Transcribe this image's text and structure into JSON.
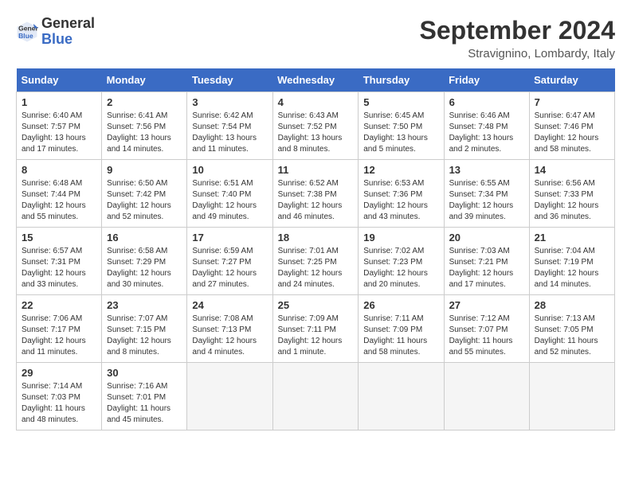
{
  "header": {
    "logo_line1": "General",
    "logo_line2": "Blue",
    "month": "September 2024",
    "location": "Stravignino, Lombardy, Italy"
  },
  "weekdays": [
    "Sunday",
    "Monday",
    "Tuesday",
    "Wednesday",
    "Thursday",
    "Friday",
    "Saturday"
  ],
  "weeks": [
    [
      {
        "day": "1",
        "sunrise": "6:40 AM",
        "sunset": "7:57 PM",
        "daylight": "13 hours and 17 minutes."
      },
      {
        "day": "2",
        "sunrise": "6:41 AM",
        "sunset": "7:56 PM",
        "daylight": "13 hours and 14 minutes."
      },
      {
        "day": "3",
        "sunrise": "6:42 AM",
        "sunset": "7:54 PM",
        "daylight": "13 hours and 11 minutes."
      },
      {
        "day": "4",
        "sunrise": "6:43 AM",
        "sunset": "7:52 PM",
        "daylight": "13 hours and 8 minutes."
      },
      {
        "day": "5",
        "sunrise": "6:45 AM",
        "sunset": "7:50 PM",
        "daylight": "13 hours and 5 minutes."
      },
      {
        "day": "6",
        "sunrise": "6:46 AM",
        "sunset": "7:48 PM",
        "daylight": "13 hours and 2 minutes."
      },
      {
        "day": "7",
        "sunrise": "6:47 AM",
        "sunset": "7:46 PM",
        "daylight": "12 hours and 58 minutes."
      }
    ],
    [
      {
        "day": "8",
        "sunrise": "6:48 AM",
        "sunset": "7:44 PM",
        "daylight": "12 hours and 55 minutes."
      },
      {
        "day": "9",
        "sunrise": "6:50 AM",
        "sunset": "7:42 PM",
        "daylight": "12 hours and 52 minutes."
      },
      {
        "day": "10",
        "sunrise": "6:51 AM",
        "sunset": "7:40 PM",
        "daylight": "12 hours and 49 minutes."
      },
      {
        "day": "11",
        "sunrise": "6:52 AM",
        "sunset": "7:38 PM",
        "daylight": "12 hours and 46 minutes."
      },
      {
        "day": "12",
        "sunrise": "6:53 AM",
        "sunset": "7:36 PM",
        "daylight": "12 hours and 43 minutes."
      },
      {
        "day": "13",
        "sunrise": "6:55 AM",
        "sunset": "7:34 PM",
        "daylight": "12 hours and 39 minutes."
      },
      {
        "day": "14",
        "sunrise": "6:56 AM",
        "sunset": "7:33 PM",
        "daylight": "12 hours and 36 minutes."
      }
    ],
    [
      {
        "day": "15",
        "sunrise": "6:57 AM",
        "sunset": "7:31 PM",
        "daylight": "12 hours and 33 minutes."
      },
      {
        "day": "16",
        "sunrise": "6:58 AM",
        "sunset": "7:29 PM",
        "daylight": "12 hours and 30 minutes."
      },
      {
        "day": "17",
        "sunrise": "6:59 AM",
        "sunset": "7:27 PM",
        "daylight": "12 hours and 27 minutes."
      },
      {
        "day": "18",
        "sunrise": "7:01 AM",
        "sunset": "7:25 PM",
        "daylight": "12 hours and 24 minutes."
      },
      {
        "day": "19",
        "sunrise": "7:02 AM",
        "sunset": "7:23 PM",
        "daylight": "12 hours and 20 minutes."
      },
      {
        "day": "20",
        "sunrise": "7:03 AM",
        "sunset": "7:21 PM",
        "daylight": "12 hours and 17 minutes."
      },
      {
        "day": "21",
        "sunrise": "7:04 AM",
        "sunset": "7:19 PM",
        "daylight": "12 hours and 14 minutes."
      }
    ],
    [
      {
        "day": "22",
        "sunrise": "7:06 AM",
        "sunset": "7:17 PM",
        "daylight": "12 hours and 11 minutes."
      },
      {
        "day": "23",
        "sunrise": "7:07 AM",
        "sunset": "7:15 PM",
        "daylight": "12 hours and 8 minutes."
      },
      {
        "day": "24",
        "sunrise": "7:08 AM",
        "sunset": "7:13 PM",
        "daylight": "12 hours and 4 minutes."
      },
      {
        "day": "25",
        "sunrise": "7:09 AM",
        "sunset": "7:11 PM",
        "daylight": "12 hours and 1 minute."
      },
      {
        "day": "26",
        "sunrise": "7:11 AM",
        "sunset": "7:09 PM",
        "daylight": "11 hours and 58 minutes."
      },
      {
        "day": "27",
        "sunrise": "7:12 AM",
        "sunset": "7:07 PM",
        "daylight": "11 hours and 55 minutes."
      },
      {
        "day": "28",
        "sunrise": "7:13 AM",
        "sunset": "7:05 PM",
        "daylight": "11 hours and 52 minutes."
      }
    ],
    [
      {
        "day": "29",
        "sunrise": "7:14 AM",
        "sunset": "7:03 PM",
        "daylight": "11 hours and 48 minutes."
      },
      {
        "day": "30",
        "sunrise": "7:16 AM",
        "sunset": "7:01 PM",
        "daylight": "11 hours and 45 minutes."
      },
      null,
      null,
      null,
      null,
      null
    ]
  ]
}
